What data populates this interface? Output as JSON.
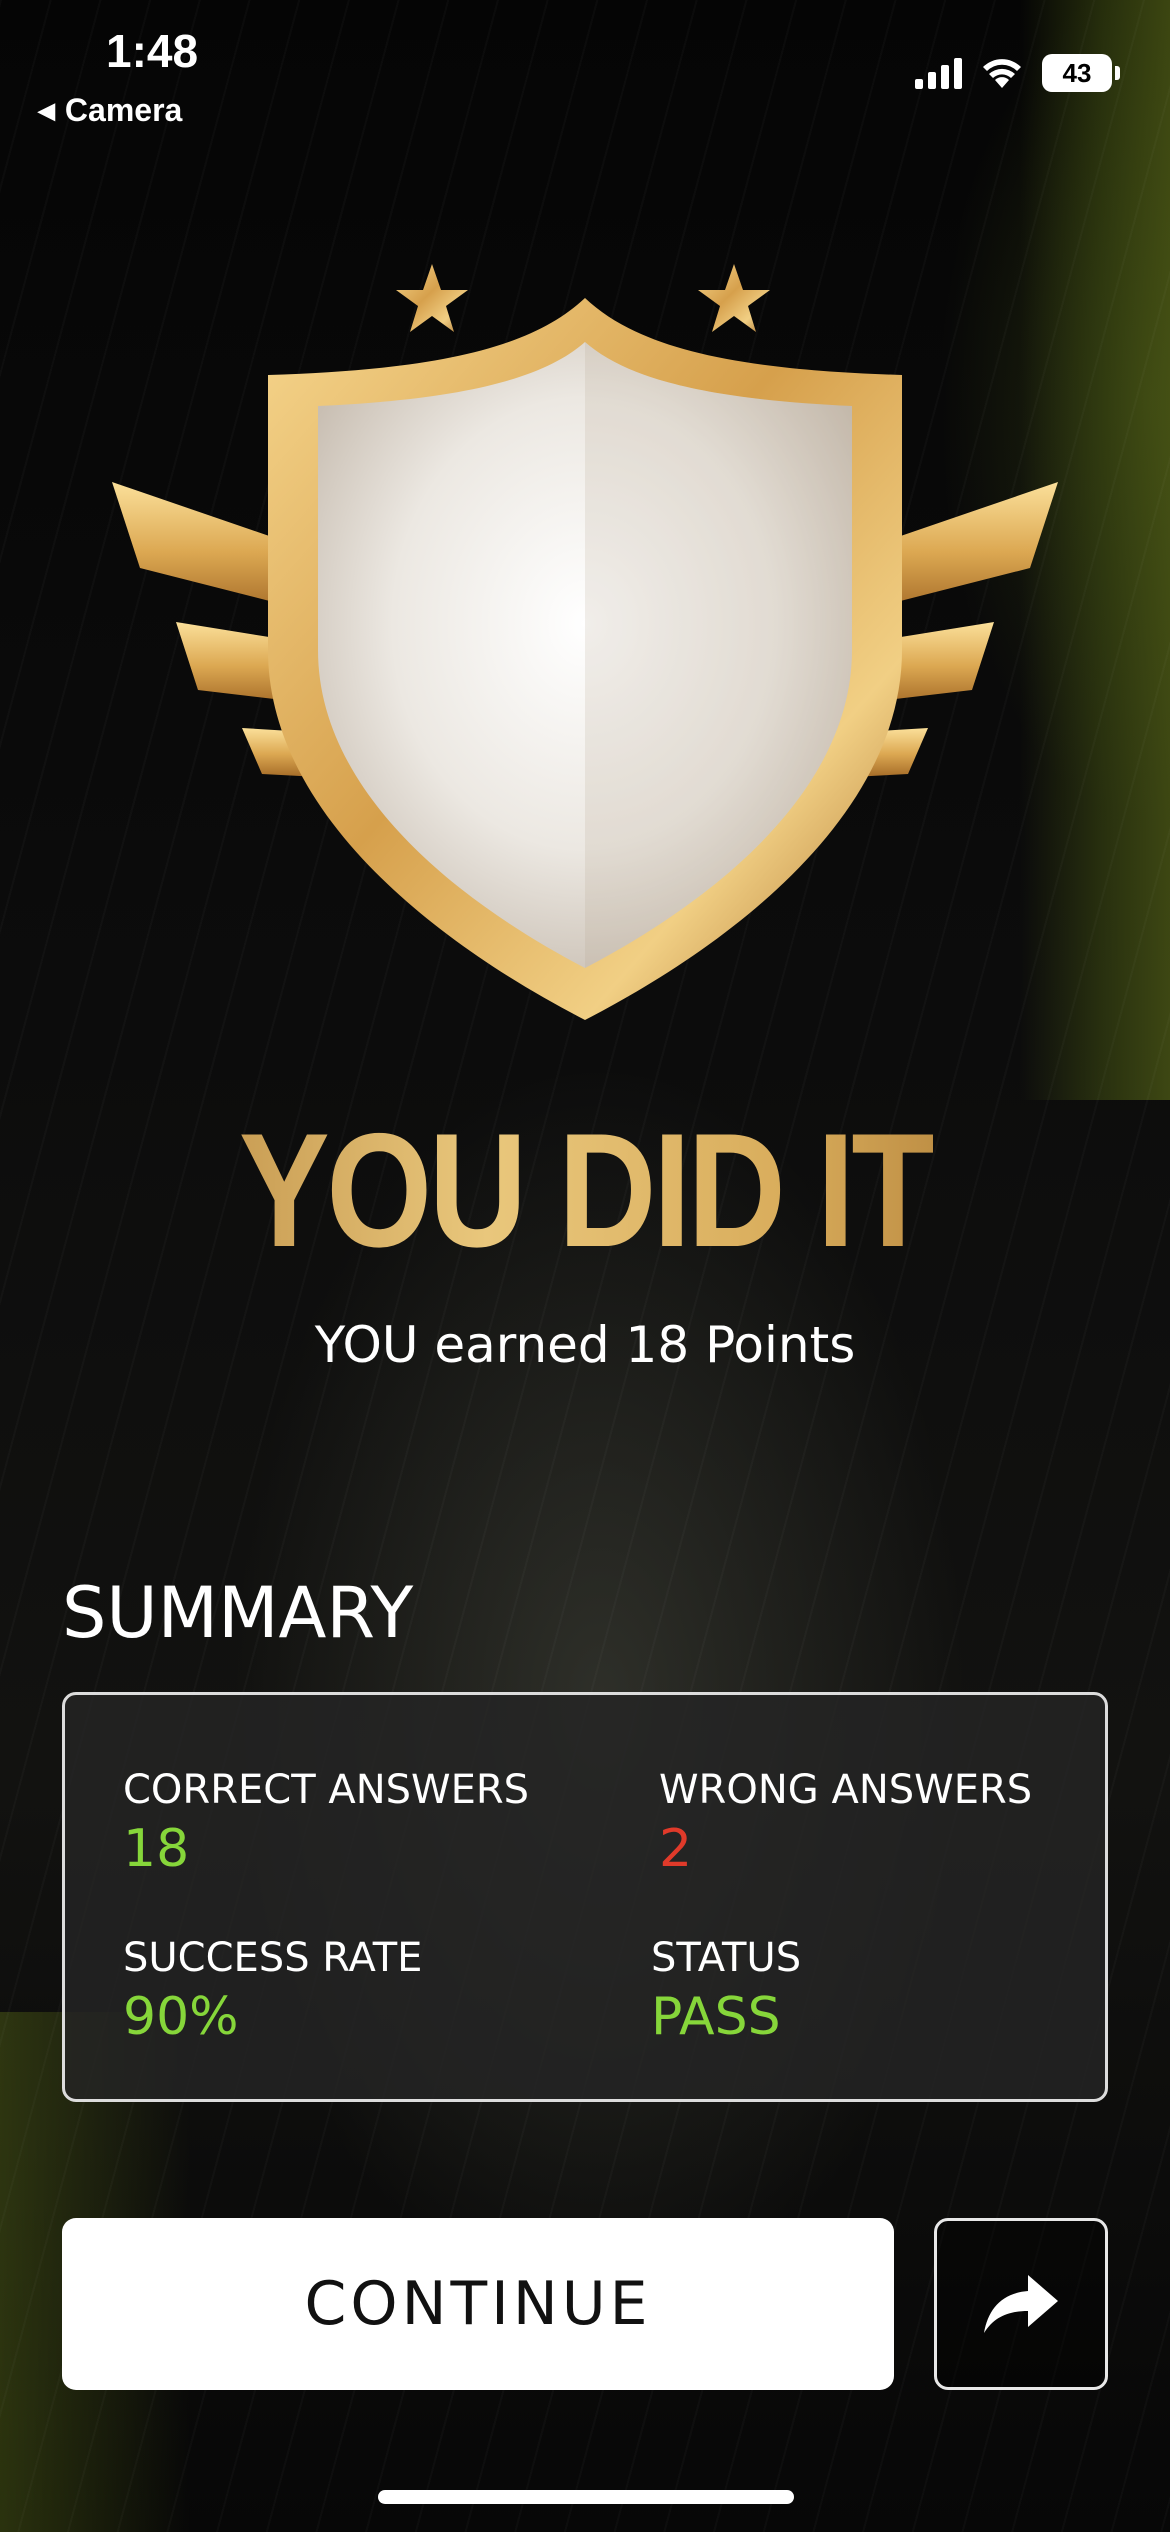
{
  "status_bar": {
    "time": "1:48",
    "back_label": "Camera",
    "battery": "43"
  },
  "hero": {
    "headline": "YOU DID IT",
    "subline": "YOU earned 18 Points"
  },
  "summary": {
    "title": "SUMMARY",
    "correct_label": "CORRECT ANSWERS",
    "correct_value": "18",
    "wrong_label": "WRONG ANSWERS",
    "wrong_value": "2",
    "rate_label": "SUCCESS RATE",
    "rate_value": "90%",
    "status_label": "STATUS",
    "status_value": "PASS"
  },
  "actions": {
    "continue_label": "CONTINUE",
    "share_icon": "share-arrow-icon"
  },
  "colors": {
    "gold": "#d9ad5c",
    "success_green": "#86d63a",
    "error_red": "#e03a2a"
  }
}
